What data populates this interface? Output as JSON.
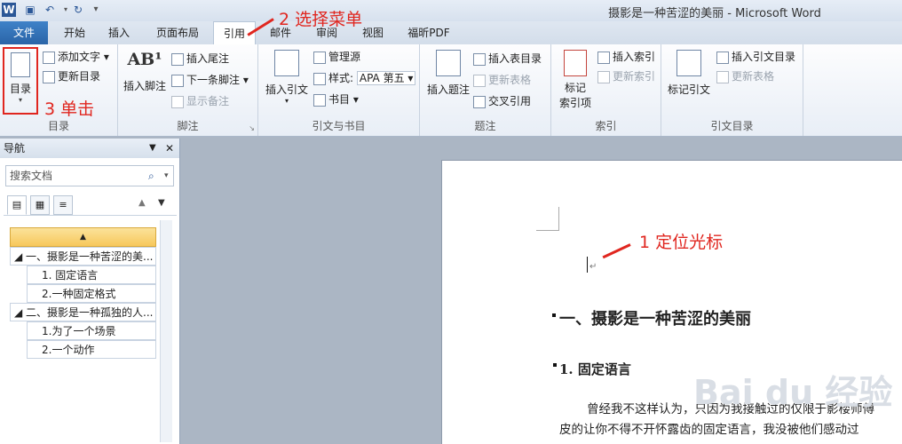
{
  "title": "摄影是一种苦涩的美丽 - Microsoft Word",
  "quick_access": {
    "app_icon": "W",
    "save_icon": "save-icon",
    "undo_icon": "undo-icon",
    "redo_icon": "redo-icon"
  },
  "tabs": [
    "文件",
    "开始",
    "插入",
    "页面布局",
    "引用",
    "邮件",
    "审阅",
    "视图",
    "福昕PDF"
  ],
  "ribbon": {
    "toc_group": {
      "big_button": "目录",
      "add_text": "添加文字",
      "update_toc": "更新目录",
      "label": "目录"
    },
    "footnote_group": {
      "insert_footnote": "插入脚注",
      "insert_endnote": "插入尾注",
      "next_footnote": "下一条脚注",
      "show_notes": "显示备注",
      "label": "脚注",
      "ab_glyph": "AB¹"
    },
    "citation_group": {
      "insert_citation": "插入引文",
      "manage_sources": "管理源",
      "style_label": "样式:",
      "style_value": "APA 第五",
      "bibliography": "书目",
      "label": "引文与书目"
    },
    "caption_group": {
      "insert_caption": "插入题注",
      "insert_table_figures": "插入表目录",
      "update_table": "更新表格",
      "cross_reference": "交叉引用",
      "label": "题注"
    },
    "index_group": {
      "mark_entry_line1": "标记",
      "mark_entry_line2": "索引项",
      "insert_index": "插入索引",
      "update_index": "更新索引",
      "label": "索引"
    },
    "toa_group": {
      "mark_citation": "标记引文",
      "insert_toa": "插入引文目录",
      "update_table": "更新表格",
      "label": "引文目录"
    }
  },
  "nav": {
    "title": "导航",
    "search_placeholder": "搜索文档",
    "headings": [
      {
        "text": "一、摄影是一种苦涩的美...",
        "level": 1
      },
      {
        "text": "1. 固定语言",
        "level": 2
      },
      {
        "text": "2.一种固定格式",
        "level": 2
      },
      {
        "text": "二、摄影是一种孤独的人...",
        "level": 1
      },
      {
        "text": "1.为了一个场景",
        "level": 2
      },
      {
        "text": "2.一个动作",
        "level": 2
      }
    ]
  },
  "document": {
    "heading1": "一、摄影是一种苦涩的美丽",
    "heading2": "1. 固定语言",
    "para_line1": "曾经我不这样认为，只因为我接触过的仅限于影楼师傅",
    "para_line2": "皮的让你不得不开怀露齿的固定语言，我没被他们感动过",
    "watermark": "Bai du 经验"
  },
  "annotations": {
    "step1": "1 定位光标",
    "step2": "2 选择菜单",
    "step3": "3 单击"
  },
  "colors": {
    "annotation": "#e0261f",
    "file_tab": "#2a64a7"
  }
}
